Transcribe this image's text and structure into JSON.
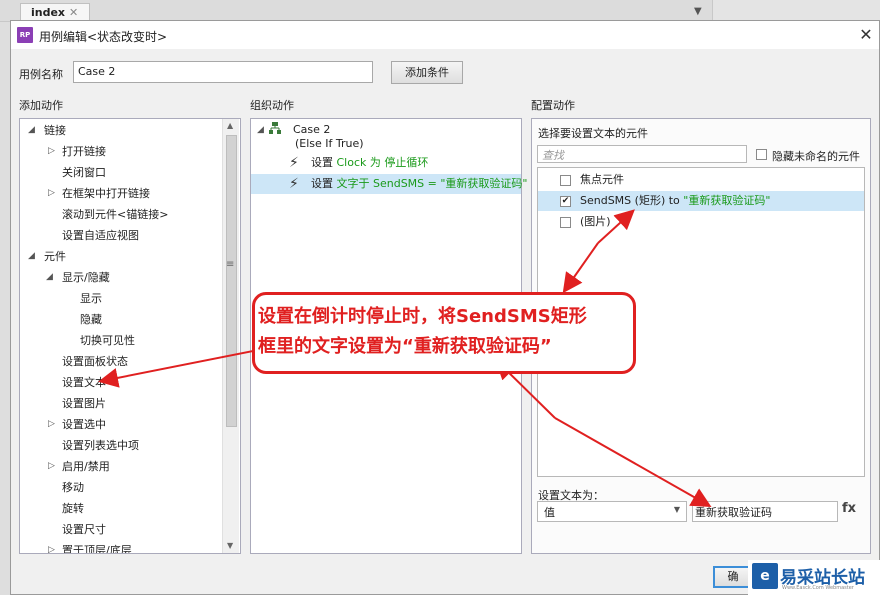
{
  "background_tab": {
    "label": "index",
    "close": "✕"
  },
  "dialog": {
    "title": "用例编辑<状态改变时>",
    "case_name_label": "用例名称",
    "case_name_value": "Case 2",
    "add_condition_button": "添加条件"
  },
  "sections": {
    "add_action": "添加动作",
    "organize_action": "组织动作",
    "configure_action": "配置动作"
  },
  "action_tree": [
    {
      "label": "链接"
    },
    {
      "label": "打开链接"
    },
    {
      "label": "关闭窗口"
    },
    {
      "label": "在框架中打开链接"
    },
    {
      "label": "滚动到元件<锚链接>"
    },
    {
      "label": "设置自适应视图"
    },
    {
      "label": "元件"
    },
    {
      "label": "显示/隐藏"
    },
    {
      "label": "显示"
    },
    {
      "label": "隐藏"
    },
    {
      "label": "切换可见性"
    },
    {
      "label": "设置面板状态"
    },
    {
      "label": "设置文本"
    },
    {
      "label": "设置图片"
    },
    {
      "label": "设置选中"
    },
    {
      "label": "设置列表选中项"
    },
    {
      "label": "启用/禁用"
    },
    {
      "label": "移动"
    },
    {
      "label": "旋转"
    },
    {
      "label": "设置尺寸"
    },
    {
      "label": "置于顶层/底层"
    }
  ],
  "organize": {
    "case_title": "Case 2",
    "case_condition": "(Else If True)",
    "actions": [
      {
        "prefix": "设置",
        "detail": "Clock 为 停止循环"
      },
      {
        "prefix": "设置",
        "detail": "文字于 SendSMS = \"重新获取验证码\""
      }
    ]
  },
  "configure": {
    "select_label": "选择要设置文本的元件",
    "search_placeholder": "查找",
    "hide_unnamed_label": "隐藏未命名的元件",
    "elements": [
      {
        "name": "焦点元件",
        "suffix": "",
        "checked": false
      },
      {
        "name": "SendSMS (矩形) to",
        "suffix": "\"重新获取验证码\"",
        "checked": true
      },
      {
        "name": "(图片)",
        "suffix": "",
        "checked": false
      }
    ],
    "set_text_label": "设置文本为：",
    "value_type": "值",
    "value_text": "重新获取验证码",
    "fx": "fx"
  },
  "callout": {
    "line1": "设置在倒计时停止时，将SendSMS矩形",
    "line2": "框里的文字设置为“重新获取验证码”"
  },
  "ok_button_partial": "确",
  "watermark": {
    "brand": "易采站长站",
    "sub": "Www.Easck.Com Webmaster"
  },
  "colors": {
    "accent_red": "#e02020",
    "selection_blue": "#cde6f7",
    "green_text": "#1a9a1a"
  }
}
